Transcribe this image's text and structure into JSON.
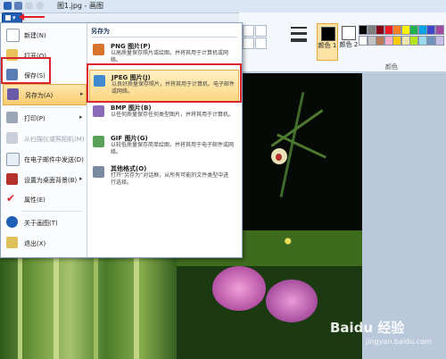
{
  "title_bar": {
    "title": "图1.jpg - 画图"
  },
  "app_menu": {
    "items": [
      {
        "label": "新建(N)",
        "icon": "new-file-icon"
      },
      {
        "label": "打开(O)",
        "icon": "open-folder-icon"
      },
      {
        "label": "保存(S)",
        "icon": "save-disk-icon"
      },
      {
        "label": "另存为(A)",
        "icon": "save-as-icon",
        "selected": true
      },
      {
        "label": "打印(P)",
        "icon": "printer-icon"
      },
      {
        "label": "从扫描仪或照相机(M)",
        "icon": "scanner-icon",
        "disabled": true
      },
      {
        "label": "在电子邮件中发送(D)",
        "icon": "email-icon"
      },
      {
        "label": "设置为桌面背景(B)",
        "icon": "desktop-background-icon"
      },
      {
        "label": "属性(E)",
        "icon": "checkmark-icon"
      },
      {
        "label": "关于画图(T)",
        "icon": "info-icon"
      },
      {
        "label": "退出(X)",
        "icon": "exit-icon"
      }
    ],
    "submenu": {
      "title": "另存为",
      "items": [
        {
          "title": "PNG 图片(P)",
          "desc": "以高质量保存照片或绘图，并将其用于计算机或网络。",
          "icon": "png-image-icon"
        },
        {
          "title": "JPEG 图片(J)",
          "desc": "以良好质量保存照片，并将其用于计算机、电子邮件或网络。",
          "icon": "jpeg-image-icon",
          "highlighted": true
        },
        {
          "title": "BMP 图片(B)",
          "desc": "以任何质量保存任何类型图片，并将其用于计算机。",
          "icon": "bmp-image-icon"
        },
        {
          "title": "GIF 图片(G)",
          "desc": "以较低质量保存简单绘图，并将其用于电子邮件或网络。",
          "icon": "gif-image-icon"
        },
        {
          "title": "其他格式(O)",
          "desc": "打开“另存为”对话框，从所有可能的文件类型中进行选择。",
          "icon": "other-formats-icon"
        }
      ]
    }
  },
  "ribbon": {
    "color1_label": "颜色 1",
    "color2_label": "颜色 2",
    "colors_group_label": "颜色",
    "palette": [
      "#000000",
      "#7f7f7f",
      "#880015",
      "#ed1c24",
      "#ff7f27",
      "#fff200",
      "#22b14c",
      "#00a2e8",
      "#3f48cc",
      "#a349a4",
      "#ffffff",
      "#c3c3c3",
      "#b97a57",
      "#ffaec9",
      "#ffc90e",
      "#efe4b0",
      "#b5e61d",
      "#99d9ea",
      "#7092be",
      "#c8bfe7"
    ]
  },
  "watermark": {
    "brand": "Baidu 经验",
    "url": "jingyan.baidu.com"
  },
  "colors": {
    "accent_red": "#d9262c",
    "menu_highlight": "#fbd681"
  }
}
